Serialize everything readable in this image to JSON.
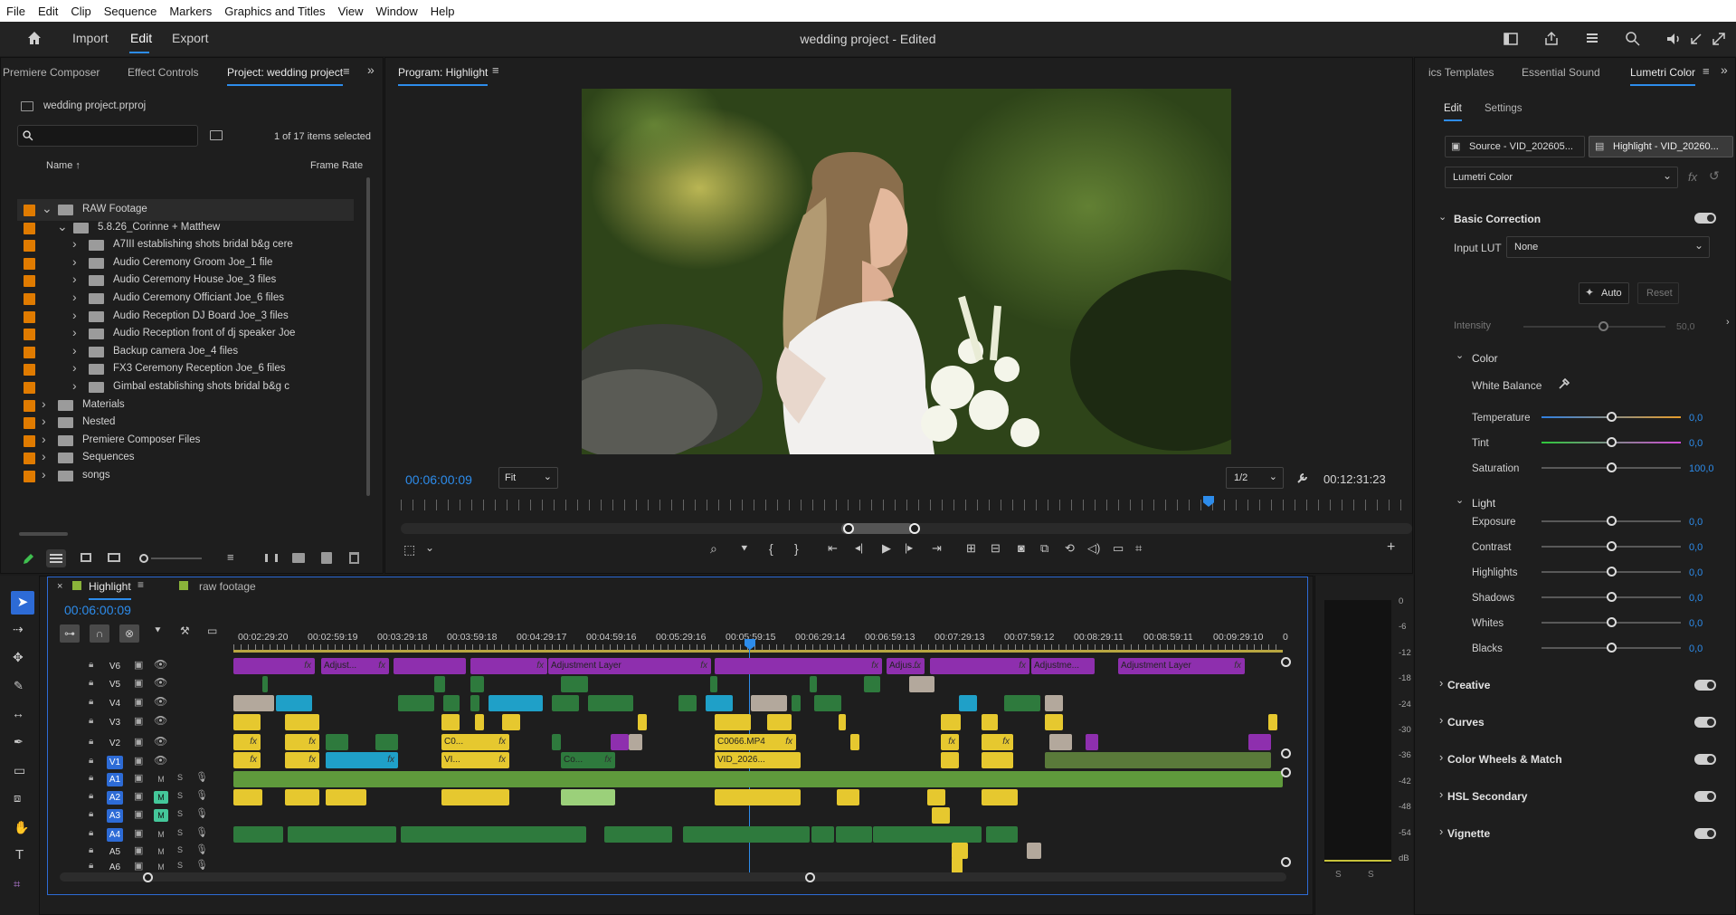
{
  "menubar": [
    "File",
    "Edit",
    "Clip",
    "Sequence",
    "Markers",
    "Graphics and Titles",
    "View",
    "Window",
    "Help"
  ],
  "header": {
    "nav": [
      "Import",
      "Edit",
      "Export"
    ],
    "active_nav": "Edit",
    "title": "wedding project - Edited",
    "icons": [
      "home-icon",
      "workspace-icon",
      "share-icon",
      "quick-export-icon",
      "search-icon",
      "audio-icon",
      "minimize-icon",
      "fullscreen-icon"
    ]
  },
  "left_panel": {
    "tabs": [
      "Premiere Composer",
      "Effect Controls",
      "Project: wedding project"
    ],
    "project_file": "wedding project.prproj",
    "search_placeholder": "",
    "selection_status": "1 of 17 items selected",
    "columns": {
      "name": "Name",
      "frame_rate": "Frame Rate"
    },
    "items": [
      {
        "label": "RAW Footage",
        "level": 0,
        "open": true
      },
      {
        "label": "5.8.26_Corinne + Matthew",
        "level": 1,
        "open": true
      },
      {
        "label": "A7III establishing shots bridal b&g cere",
        "level": 2,
        "open": false
      },
      {
        "label": "Audio Ceremony Groom Joe_1 file",
        "level": 2,
        "open": false
      },
      {
        "label": "Audio Ceremony House Joe_3 files",
        "level": 2,
        "open": false
      },
      {
        "label": "Audio Ceremony Officiant Joe_6 files",
        "level": 2,
        "open": false
      },
      {
        "label": "Audio Reception DJ Board Joe_3 files",
        "level": 2,
        "open": false
      },
      {
        "label": "Audio Reception front of dj speaker Joe",
        "level": 2,
        "open": false
      },
      {
        "label": "Backup camera Joe_4 files",
        "level": 2,
        "open": false
      },
      {
        "label": "FX3 Ceremony Reception Joe_6 files",
        "level": 2,
        "open": false
      },
      {
        "label": "Gimbal establishing shots bridal b&g c",
        "level": 2,
        "open": false
      },
      {
        "label": "Materials",
        "level": 0,
        "open": false
      },
      {
        "label": "Nested",
        "level": 0,
        "open": false
      },
      {
        "label": "Premiere Composer Files",
        "level": 0,
        "open": false
      },
      {
        "label": "Sequences",
        "level": 0,
        "open": false
      },
      {
        "label": "songs",
        "level": 0,
        "open": false
      }
    ]
  },
  "program": {
    "tab": "Program: Highlight",
    "timecode_current": "00:06:00:09",
    "fit": "Fit",
    "resolution": "1/2",
    "timecode_duration": "00:12:31:23",
    "playhead_fraction": 0.8
  },
  "right_panel": {
    "tabs": [
      "ics Templates",
      "Essential Sound",
      "Lumetri Color"
    ],
    "subtabs": [
      "Edit",
      "Settings"
    ],
    "source_btn": "Source - VID_202605...",
    "highlight_btn": "Highlight - VID_20260...",
    "effect": "Lumetri Color",
    "basic_correction": "Basic Correction",
    "input_lut_label": "Input LUT",
    "input_lut_value": "None",
    "auto": "Auto",
    "reset": "Reset",
    "intensity": {
      "label": "Intensity",
      "value": "50,0"
    },
    "color_header": "Color",
    "white_balance": "White Balance",
    "color_rows": [
      {
        "label": "Temperature",
        "value": "0,0"
      },
      {
        "label": "Tint",
        "value": "0,0"
      },
      {
        "label": "Saturation",
        "value": "100,0"
      }
    ],
    "light_header": "Light",
    "light_rows": [
      {
        "label": "Exposure",
        "value": "0,0"
      },
      {
        "label": "Contrast",
        "value": "0,0"
      },
      {
        "label": "Highlights",
        "value": "0,0"
      },
      {
        "label": "Shadows",
        "value": "0,0"
      },
      {
        "label": "Whites",
        "value": "0,0"
      },
      {
        "label": "Blacks",
        "value": "0,0"
      }
    ],
    "sections": [
      "Creative",
      "Curves",
      "Color Wheels & Match",
      "HSL Secondary",
      "Vignette"
    ]
  },
  "timeline": {
    "tabs": [
      "Highlight",
      "raw footage"
    ],
    "timecode": "00:06:00:09",
    "ruler": [
      "00:02:29:20",
      "00:02:59:19",
      "00:03:29:18",
      "00:03:59:18",
      "00:04:29:17",
      "00:04:59:16",
      "00:05:29:16",
      "00:05:59:15",
      "00:06:29:14",
      "00:06:59:13",
      "00:07:29:13",
      "00:07:59:12",
      "00:08:29:11",
      "00:08:59:11",
      "00:09:29:10",
      "0"
    ],
    "video_tracks": [
      "V6",
      "V5",
      "V4",
      "V3",
      "V2",
      "V1"
    ],
    "audio_tracks": [
      "A1",
      "A2",
      "A3",
      "A4",
      "A5",
      "A6"
    ],
    "clip_labels": [
      "Adjust...",
      "Adjustment Layer",
      "Adjus...",
      "Adjustme...",
      "Adjustment Layer",
      "C0...",
      "C0066.MP4",
      "VI...",
      "Co...",
      "VID_2026..."
    ],
    "fx": "fx",
    "m": "M",
    "s": "S",
    "meter_scale": [
      "0",
      "-6",
      "-12",
      "-18",
      "-24",
      "-30",
      "-36",
      "-42",
      "-48",
      "-54",
      "dB"
    ],
    "meter_footer": [
      "S",
      "S"
    ]
  }
}
